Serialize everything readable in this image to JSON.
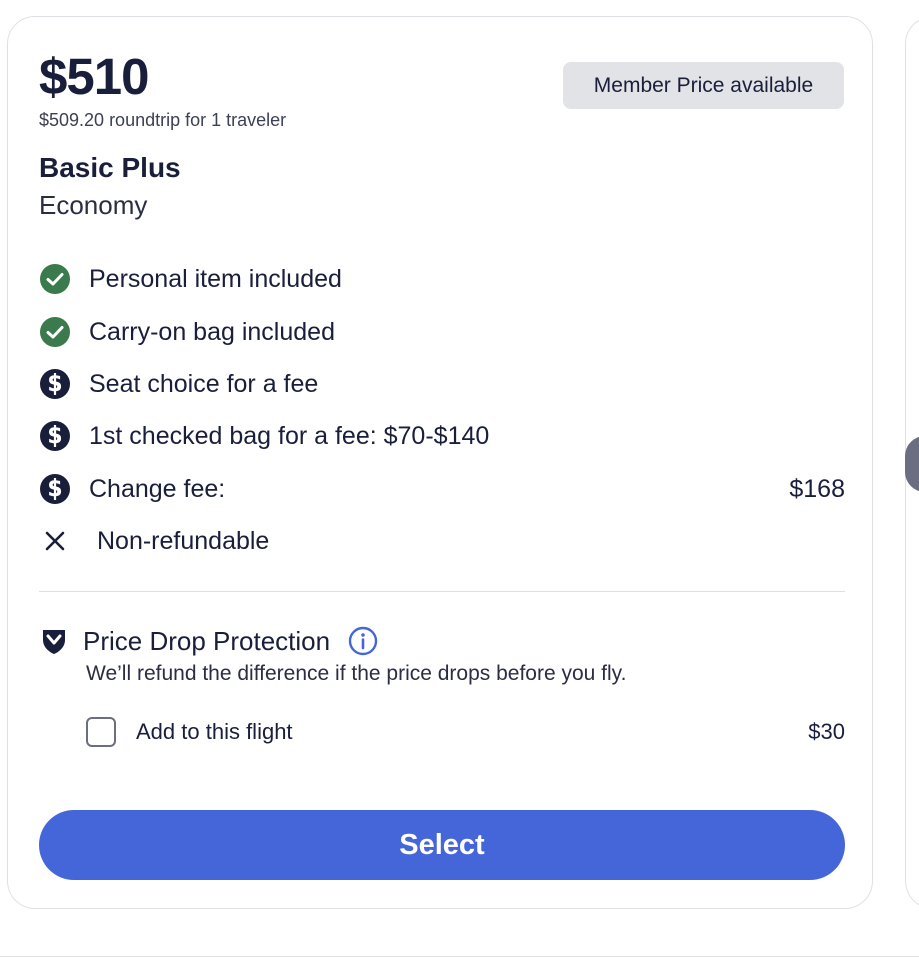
{
  "fare": {
    "price": "$510",
    "price_detail": "$509.20 roundtrip for 1 traveler",
    "badge": "Member Price available",
    "name": "Basic Plus",
    "cabin": "Economy"
  },
  "features": [
    {
      "icon": "check-circle-icon",
      "label": "Personal item included",
      "amount": ""
    },
    {
      "icon": "check-circle-icon",
      "label": "Carry-on bag included",
      "amount": ""
    },
    {
      "icon": "dollar-circle-icon",
      "label": "Seat choice for a fee",
      "amount": ""
    },
    {
      "icon": "dollar-circle-icon",
      "label": "1st checked bag for a fee: $70-$140",
      "amount": ""
    },
    {
      "icon": "dollar-circle-icon",
      "label": "Change fee:",
      "amount": "$168"
    },
    {
      "icon": "x-icon",
      "label": "Non-refundable",
      "amount": ""
    }
  ],
  "price_drop": {
    "title": "Price Drop Protection",
    "description": "We’ll refund the difference if the price drops before you fly.",
    "add_label": "Add to this flight",
    "add_price": "$30",
    "checked": false
  },
  "actions": {
    "select_label": "Select"
  },
  "colors": {
    "accent": "#4566d9",
    "check_green": "#3a7a4c",
    "text_dark": "#191e3b",
    "badge_bg": "#e2e3e6"
  }
}
